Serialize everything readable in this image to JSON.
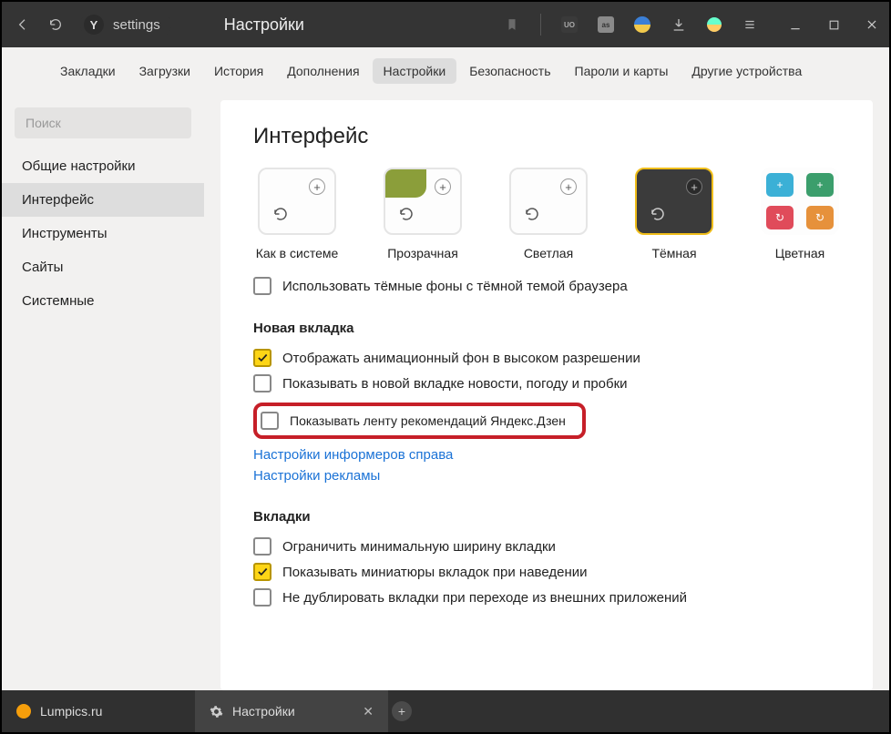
{
  "titlebar": {
    "locality": "settings",
    "title": "Настройки"
  },
  "topnav": {
    "items": [
      "Закладки",
      "Загрузки",
      "История",
      "Дополнения",
      "Настройки",
      "Безопасность",
      "Пароли и карты",
      "Другие устройства"
    ],
    "activeIndex": 4
  },
  "sidebar": {
    "search_placeholder": "Поиск",
    "items": [
      "Общие настройки",
      "Интерфейс",
      "Инструменты",
      "Сайты",
      "Системные"
    ],
    "activeIndex": 1
  },
  "content": {
    "heading": "Интерфейс",
    "themes": [
      "Как в системе",
      "Прозрачная",
      "Светлая",
      "Тёмная",
      "Цветная"
    ],
    "opt_dark_bg": "Использовать тёмные фоны с тёмной темой браузера",
    "section_newtab": "Новая вкладка",
    "newtab": {
      "hires": "Отображать анимационный фон в высоком разрешении",
      "news": "Показывать в новой вкладке новости, погоду и пробки",
      "zen": "Показывать ленту рекомендаций Яндекс.Дзен"
    },
    "link_informers": "Настройки информеров справа",
    "link_ads": "Настройки рекламы",
    "section_tabs": "Вкладки",
    "tabs": {
      "minwidth": "Ограничить минимальную ширину вкладки",
      "previews": "Показывать миниатюры вкладок при наведении",
      "nodup": "Не дублировать вкладки при переходе из внешних приложений"
    }
  },
  "bottomtabs": {
    "tab1": "Lumpics.ru",
    "tab2": "Настройки"
  }
}
